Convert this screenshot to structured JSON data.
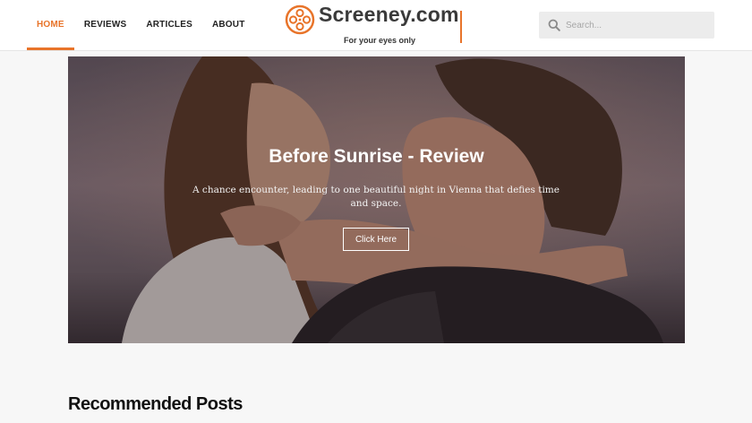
{
  "nav": {
    "items": [
      {
        "label": "HOME",
        "active": true
      },
      {
        "label": "REVIEWS",
        "active": false
      },
      {
        "label": "ARTICLES",
        "active": false
      },
      {
        "label": "ABOUT",
        "active": false
      }
    ]
  },
  "logo": {
    "title": "Screeney.com",
    "tagline": "For your eyes only",
    "icon": "film-reel-icon"
  },
  "search": {
    "placeholder": "Search...",
    "value": "",
    "icon": "search-icon"
  },
  "hero": {
    "title": "Before Sunrise - Review",
    "subtitle": "A chance encounter, leading to one beautiful night in Vienna that defies time and space.",
    "button_label": "Click Here"
  },
  "recommended": {
    "title": "Recommended Posts"
  },
  "colors": {
    "accent": "#e8742a",
    "background": "#f7f7f7",
    "search_bg": "#ececec"
  }
}
